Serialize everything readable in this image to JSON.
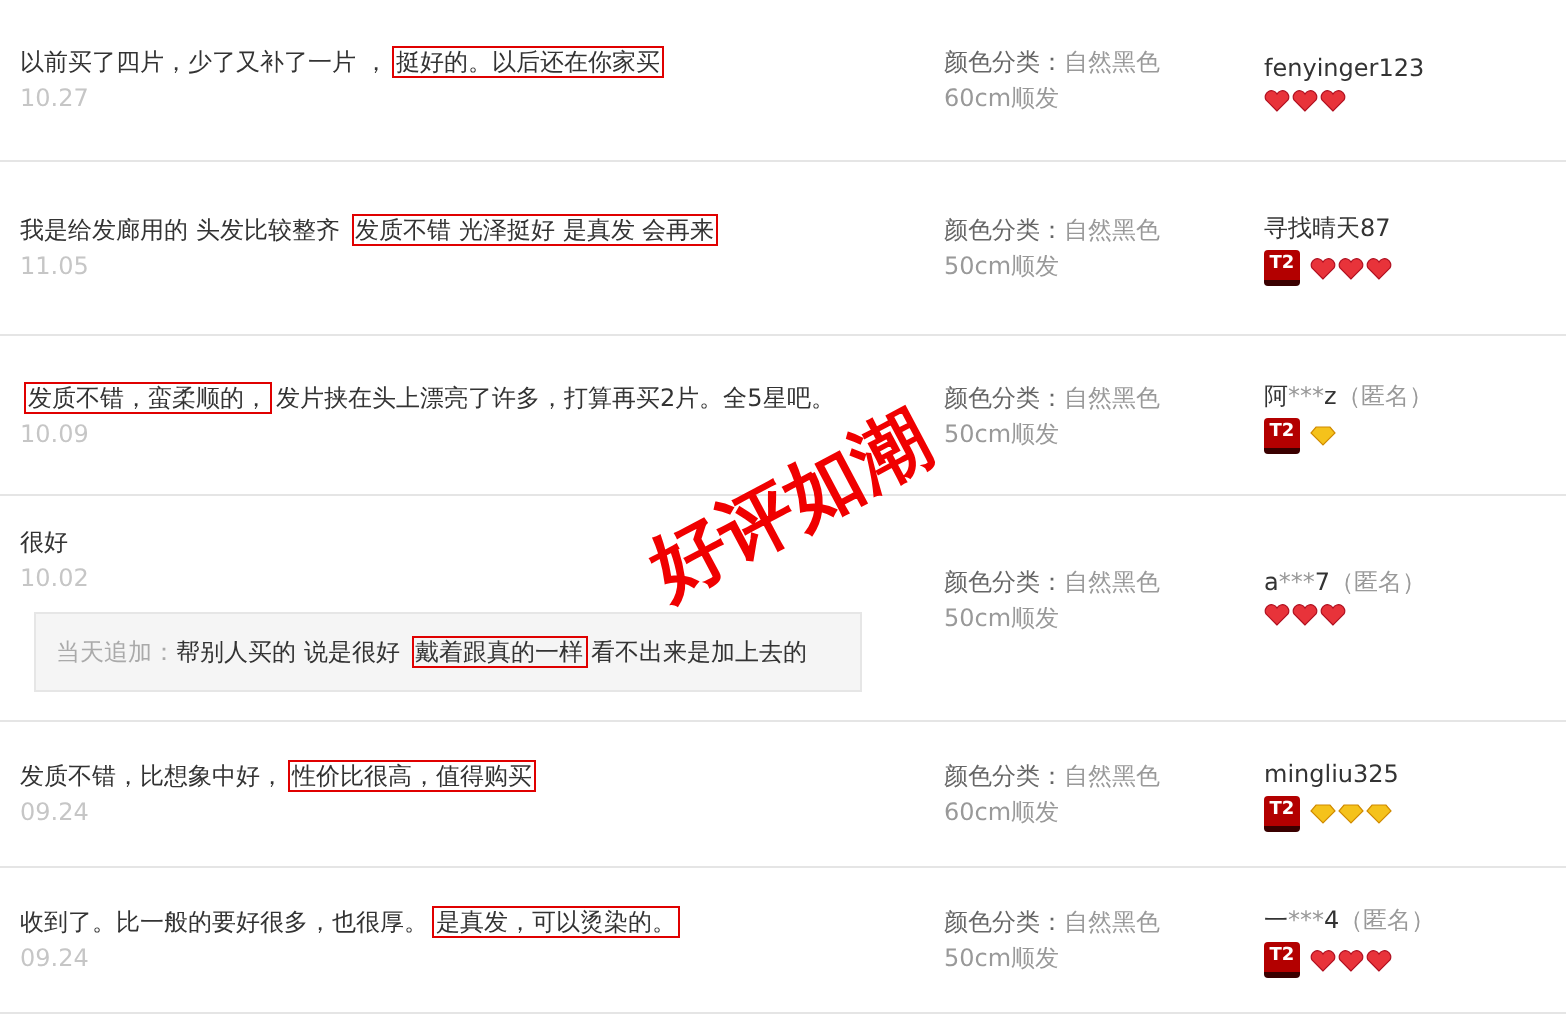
{
  "reviews": [
    {
      "comment": [
        {
          "text": "以前买了四片，少了又补了一片 ，",
          "boxed": false
        },
        {
          "text": "挺好的。以后还在你家买",
          "boxed": true
        }
      ],
      "date": "10.27",
      "sku_label": "颜色分类：",
      "sku_value": "自然黑色",
      "sku_length": "60cm顺发",
      "user": [
        {
          "text": "fenyinger123",
          "muted": false
        }
      ],
      "rank": [
        {
          "kind": "heart"
        },
        {
          "kind": "heart"
        },
        {
          "kind": "heart"
        }
      ]
    },
    {
      "comment": [
        {
          "text": "我是给发廊用的 头发比较整齐 ",
          "boxed": false
        },
        {
          "text": "发质不错 光泽挺好 是真发 会再来",
          "boxed": true
        }
      ],
      "date": "11.05",
      "sku_label": "颜色分类：",
      "sku_value": "自然黑色",
      "sku_length": "50cm顺发",
      "user": [
        {
          "text": "寻找晴天87",
          "muted": false
        }
      ],
      "badge": "T2",
      "rank": [
        {
          "kind": "heart"
        },
        {
          "kind": "heart"
        },
        {
          "kind": "heart"
        }
      ]
    },
    {
      "comment": [
        {
          "text": " 发质不错，蛮柔顺的，",
          "boxed": true
        },
        {
          "text": "发片挟在头上漂亮了许多，打算再买2片。全5星吧。",
          "boxed": false
        }
      ],
      "date": "10.09",
      "sku_label": "颜色分类：",
      "sku_value": "自然黑色",
      "sku_length": "50cm顺发",
      "user": [
        {
          "text": "阿",
          "muted": false
        },
        {
          "text": "***",
          "muted": true
        },
        {
          "text": "z",
          "muted": false
        },
        {
          "text": "（匿名）",
          "muted": true
        }
      ],
      "badge": "T2",
      "rank": [
        {
          "kind": "diamond"
        }
      ]
    },
    {
      "comment": [
        {
          "text": "很好",
          "boxed": false
        }
      ],
      "date": "10.02",
      "append_label": "当天追加：",
      "append": [
        {
          "text": "帮别人买的 说是很好 ",
          "boxed": false
        },
        {
          "text": "戴着跟真的一样",
          "boxed": true
        },
        {
          "text": "看不出来是加上去的",
          "boxed": false
        }
      ],
      "sku_label": "颜色分类：",
      "sku_value": "自然黑色",
      "sku_length": "50cm顺发",
      "user": [
        {
          "text": "a",
          "muted": false
        },
        {
          "text": "***",
          "muted": true
        },
        {
          "text": "7",
          "muted": false
        },
        {
          "text": "（匿名）",
          "muted": true
        }
      ],
      "rank": [
        {
          "kind": "heart"
        },
        {
          "kind": "heart"
        },
        {
          "kind": "heart"
        }
      ]
    },
    {
      "comment": [
        {
          "text": "发质不错，比想象中好，",
          "boxed": false
        },
        {
          "text": "性价比很高，值得购买",
          "boxed": true
        }
      ],
      "date": "09.24",
      "sku_label": "颜色分类：",
      "sku_value": "自然黑色",
      "sku_length": "60cm顺发",
      "user": [
        {
          "text": "mingliu325",
          "muted": false
        }
      ],
      "badge": "T2",
      "rank": [
        {
          "kind": "diamond"
        },
        {
          "kind": "diamond"
        },
        {
          "kind": "diamond"
        }
      ]
    },
    {
      "comment": [
        {
          "text": "收到了。比一般的要好很多，也很厚。",
          "boxed": false
        },
        {
          "text": "是真发，可以烫染的。",
          "boxed": true
        }
      ],
      "date": "09.24",
      "sku_label": "颜色分类：",
      "sku_value": "自然黑色",
      "sku_length": "50cm顺发",
      "user": [
        {
          "text": "一",
          "muted": false
        },
        {
          "text": "***",
          "muted": true
        },
        {
          "text": "4",
          "muted": false
        },
        {
          "text": "（匿名）",
          "muted": true
        }
      ],
      "badge": "T2",
      "rank": [
        {
          "kind": "heart"
        },
        {
          "kind": "heart"
        },
        {
          "kind": "heart"
        }
      ]
    }
  ],
  "stamp": "好评如潮"
}
